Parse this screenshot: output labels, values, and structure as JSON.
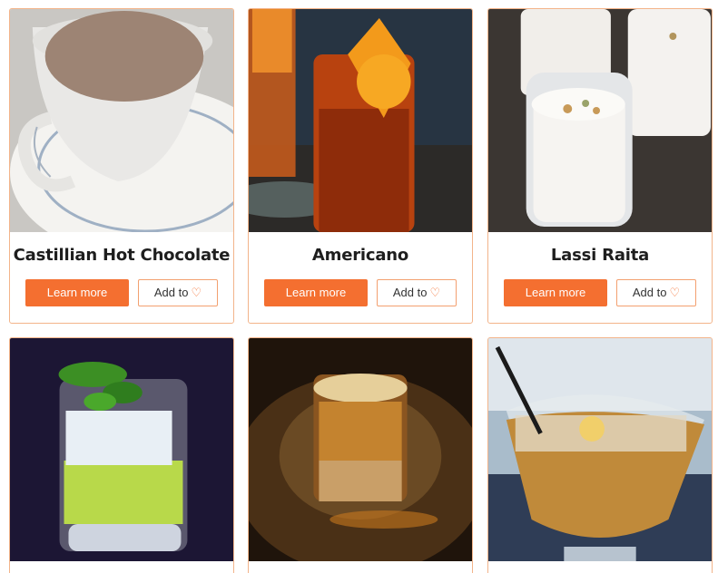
{
  "drinks": [
    {
      "title": "Castillian Hot Chocolate",
      "learn_label": "Learn more",
      "add_label": "Add to",
      "heart_icon": "heart-outline-icon"
    },
    {
      "title": "Americano",
      "learn_label": "Learn more",
      "add_label": "Add to",
      "heart_icon": "heart-outline-icon"
    },
    {
      "title": "Lassi Raita",
      "learn_label": "Learn more",
      "add_label": "Add to",
      "heart_icon": "heart-outline-icon"
    },
    {
      "title": "",
      "learn_label": "",
      "add_label": ""
    },
    {
      "title": "",
      "learn_label": "",
      "add_label": ""
    },
    {
      "title": "",
      "learn_label": "",
      "add_label": ""
    }
  ],
  "colors": {
    "accent": "#f46f30",
    "card_border": "#f3b48a",
    "title_text": "#1e1e1e"
  }
}
